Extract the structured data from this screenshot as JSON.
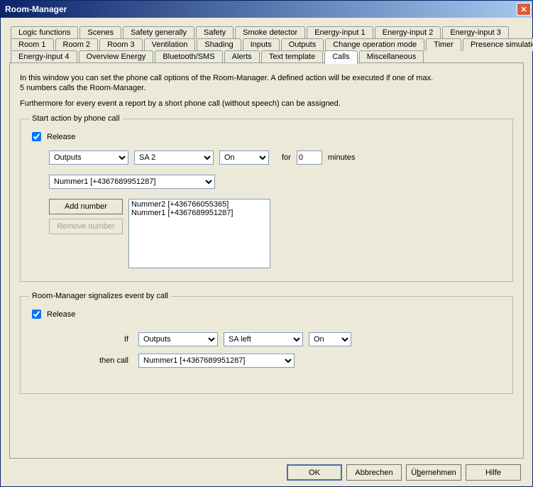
{
  "window": {
    "title": "Room-Manager"
  },
  "tabs": {
    "row1": [
      "Logic functions",
      "Scenes",
      "Safety generally",
      "Safety",
      "Smoke detector",
      "Energy-input 1",
      "Energy-input 2",
      "Energy-input 3"
    ],
    "row2": [
      "Room 1",
      "Room 2",
      "Room 3",
      "Ventilation",
      "Shading",
      "Inputs",
      "Outputs",
      "Change operation mode",
      "Timer",
      "Presence simulation"
    ],
    "row3": [
      "Energy-input 4",
      "Overview Energy",
      "Bluetooth/SMS",
      "Alerts",
      "Text template",
      "Calls",
      "Miscellaneous"
    ],
    "active": "Calls"
  },
  "description": {
    "line1": "In this window you can set the phone call options of the Room-Manager. A defined action will be executed if one of max.",
    "line2": "5 numbers calls the Room-Manager.",
    "line3": "Furthermore for every event a report by a short phone call (without speech) can be assigned."
  },
  "section1": {
    "legend": "Start action by phone call",
    "release_label": "Release",
    "release_checked": true,
    "action_category": "Outputs",
    "action_target": "SA 2",
    "action_state": "On",
    "for_label": "for",
    "minutes_value": "0",
    "minutes_label": "minutes",
    "number_select": "Nummer1 [+4367689951287]",
    "add_number_label": "Add number",
    "remove_number_label": "Remove number",
    "number_list": [
      "Nummer2 [+436766055365]",
      "Nummer1 [+4367689951287]"
    ]
  },
  "section2": {
    "legend": "Room-Manager signalizes event by call",
    "release_label": "Release",
    "release_checked": true,
    "if_label": "If",
    "if_category": "Outputs",
    "if_target": "SA left",
    "if_state": "On",
    "then_label": "then call",
    "then_number": "Nummer1 [+4367689951287]"
  },
  "buttons": {
    "ok": "OK",
    "cancel": "Abbrechen",
    "apply_pre": "Ü",
    "apply_u": "b",
    "apply_post": "ernehmen",
    "help": "Hilfe"
  }
}
